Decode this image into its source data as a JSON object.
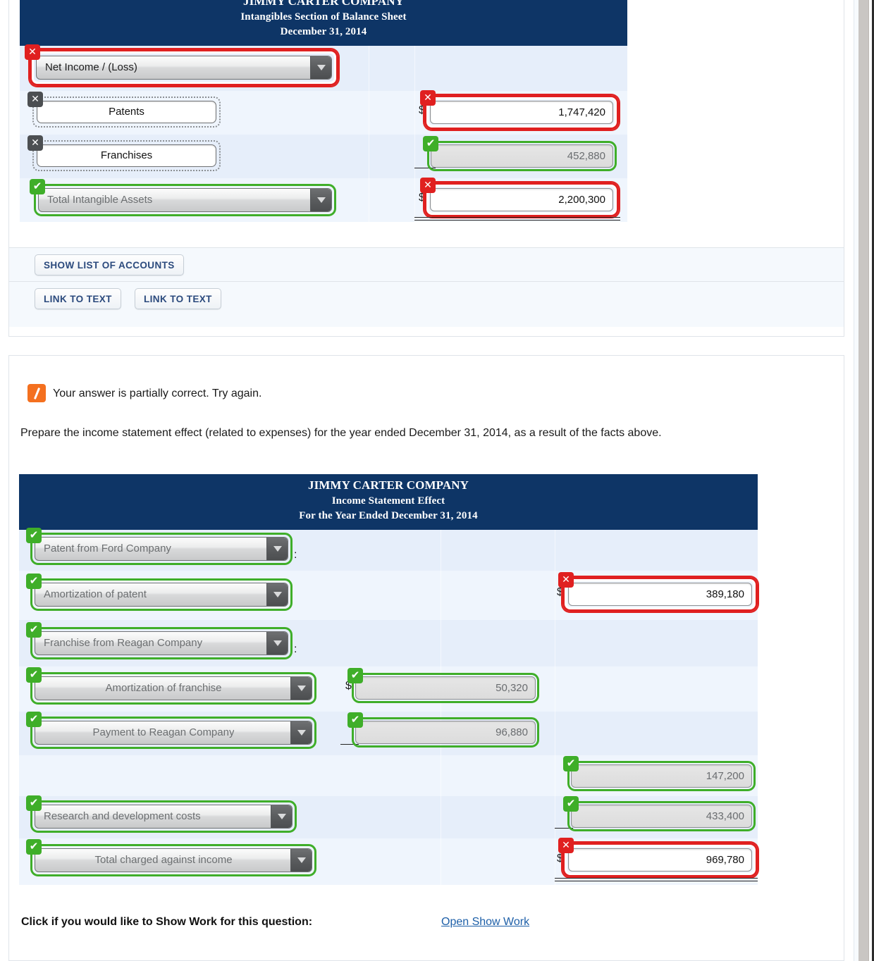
{
  "balance_sheet": {
    "header": {
      "line1": "JIMMY CARTER COMPANY",
      "line2": "Intangibles Section of Balance Sheet",
      "line3": "December 31, 2014"
    },
    "rows": [
      {
        "label": "Net Income / (Loss)",
        "label_type": "select",
        "label_status": "incorrect",
        "amount": "",
        "amount_status": "none",
        "dollar": false
      },
      {
        "label": "Patents",
        "label_type": "text",
        "label_status": "incorrect-gray",
        "amount": "1,747,420",
        "amount_status": "incorrect",
        "dollar": true
      },
      {
        "label": "Franchises",
        "label_type": "text",
        "label_status": "incorrect-gray",
        "amount": "452,880",
        "amount_status": "correct",
        "dollar": false
      },
      {
        "label": "Total Intangible Assets",
        "label_type": "select",
        "label_status": "correct",
        "amount": "2,200,300",
        "amount_status": "incorrect",
        "dollar": true
      }
    ]
  },
  "buttons": {
    "show_list_of_accounts": "SHOW LIST OF ACCOUNTS",
    "link_to_text_1": "LINK TO TEXT",
    "link_to_text_2": "LINK TO TEXT"
  },
  "feedback": {
    "icon": "partially-correct-icon",
    "message": "Your answer is partially correct.  Try again.",
    "question": "Prepare the income statement effect (related to expenses) for the year ended December 31, 2014, as a result of the facts above."
  },
  "income_statement": {
    "header": {
      "line1": "JIMMY CARTER COMPANY",
      "line2": "Income Statement Effect",
      "line3": "For the Year Ended December 31, 2014"
    },
    "rows": [
      {
        "label": "Patent from Ford Company",
        "label_status": "correct",
        "colon": true,
        "col": "none",
        "amount": "",
        "amount_status": "none"
      },
      {
        "label": "Amortization of patent",
        "label_status": "correct",
        "colon": false,
        "col": "right",
        "amount": "389,180",
        "amount_status": "incorrect",
        "dollar": true
      },
      {
        "label": "Franchise from Reagan Company",
        "label_status": "correct",
        "colon": true,
        "col": "none",
        "amount": "",
        "amount_status": "none"
      },
      {
        "label": "Amortization of franchise",
        "label_status": "correct",
        "colon": false,
        "col": "mid",
        "amount": "50,320",
        "amount_status": "correct",
        "dollar": true
      },
      {
        "label": "Payment to Reagan Company",
        "label_status": "correct",
        "colon": false,
        "col": "mid",
        "amount": "96,880",
        "amount_status": "correct",
        "dollar": false
      },
      {
        "label": "",
        "label_status": "none",
        "colon": false,
        "col": "right",
        "amount": "147,200",
        "amount_status": "correct",
        "dollar": false
      },
      {
        "label": "Research and development costs",
        "label_status": "correct",
        "colon": false,
        "col": "right",
        "amount": "433,400",
        "amount_status": "correct",
        "dollar": false
      },
      {
        "label": "Total charged against income",
        "label_status": "correct",
        "colon": false,
        "col": "right",
        "amount": "969,780",
        "amount_status": "incorrect",
        "dollar": true
      }
    ]
  },
  "show_work": {
    "label": "Click if you would like to Show Work for this question:",
    "link": "Open Show Work"
  },
  "colors": {
    "header_navy": "#0e3566",
    "correct_green": "#3fae29",
    "incorrect_red": "#e02020",
    "partial_orange": "#f4701f",
    "link_blue": "#1d5fa8"
  }
}
